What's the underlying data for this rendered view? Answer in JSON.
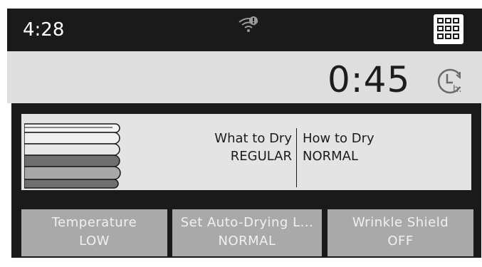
{
  "status": {
    "time": "4:28"
  },
  "icons": {
    "wifi": "wifi-alert-icon",
    "grid": "grid-menu-icon",
    "timer": "delay-timer-icon"
  },
  "timer": {
    "remaining": "0:45"
  },
  "cycle": {
    "what_label": "What to Dry",
    "what_value": "REGULAR",
    "how_label": "How to Dry",
    "how_value": "NORMAL"
  },
  "options": [
    {
      "label": "Temperature",
      "value": "LOW"
    },
    {
      "label": "Set Auto-Drying L...",
      "value": "NORMAL"
    },
    {
      "label": "Wrinkle Shield",
      "value": "OFF"
    }
  ],
  "colors": {
    "bar": "#1a1a1a",
    "panel": "#dedede",
    "option": "#a9a9a9"
  }
}
